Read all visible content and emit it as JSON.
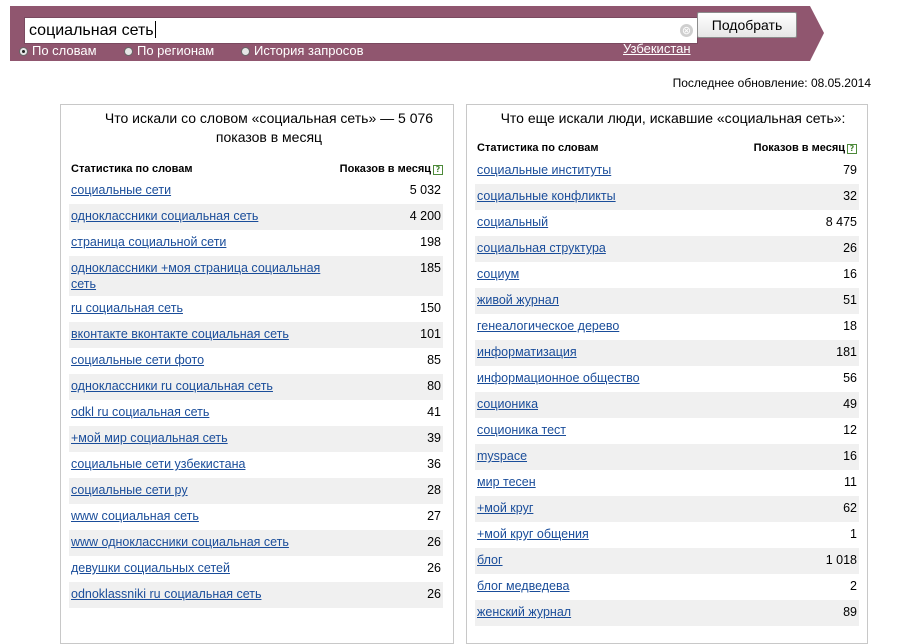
{
  "search": {
    "query": "социальная сеть",
    "button_label": "Подобрать",
    "clear_glyph": "⊗"
  },
  "modes": [
    {
      "label": "По словам",
      "selected": true
    },
    {
      "label": "По регионам",
      "selected": false
    },
    {
      "label": "История запросов",
      "selected": false
    }
  ],
  "region": "Узбекистан",
  "last_update": "Последнее обновление: 08.05.2014",
  "left_panel": {
    "title": "Что искали со словом «социальная сеть» — 5 076 показов в месяц",
    "col_phrase": "Статистика по словам",
    "col_count": "Показов в месяц",
    "rows": [
      {
        "phrase": "социальные сети",
        "count": "5 032"
      },
      {
        "phrase": "одноклассники социальная сеть",
        "count": "4 200"
      },
      {
        "phrase": "страница социальной сети",
        "count": "198"
      },
      {
        "phrase": "одноклассники +моя страница социальная сеть",
        "count": "185"
      },
      {
        "phrase": "ru социальная сеть",
        "count": "150"
      },
      {
        "phrase": "вконтакте вконтакте социальная сеть",
        "count": "101"
      },
      {
        "phrase": "социальные сети фото",
        "count": "85"
      },
      {
        "phrase": "одноклассники ru социальная сеть",
        "count": "80"
      },
      {
        "phrase": "odkl ru социальная сеть",
        "count": "41"
      },
      {
        "phrase": "+мой мир социальная сеть",
        "count": "39"
      },
      {
        "phrase": "социальные сети узбекистана",
        "count": "36"
      },
      {
        "phrase": "социальные сети ру",
        "count": "28"
      },
      {
        "phrase": "www социальная сеть",
        "count": "27"
      },
      {
        "phrase": "www одноклассники социальная сеть",
        "count": "26"
      },
      {
        "phrase": "девушки социальных сетей",
        "count": "26"
      },
      {
        "phrase": "odnoklassniki ru социальная сеть",
        "count": "26"
      }
    ]
  },
  "right_panel": {
    "title": "Что еще искали люди, искавшие «социальная сеть»:",
    "col_phrase": "Статистика по словам",
    "col_count": "Показов в месяц",
    "rows": [
      {
        "phrase": "социальные институты",
        "count": "79"
      },
      {
        "phrase": "социальные конфликты",
        "count": "32"
      },
      {
        "phrase": "социальный",
        "count": "8 475"
      },
      {
        "phrase": "социальная структура",
        "count": "26"
      },
      {
        "phrase": "социум",
        "count": "16"
      },
      {
        "phrase": "живой журнал",
        "count": "51"
      },
      {
        "phrase": "генеалогическое дерево",
        "count": "18"
      },
      {
        "phrase": "информатизация",
        "count": "181"
      },
      {
        "phrase": "информационное общество",
        "count": "56"
      },
      {
        "phrase": "соционика",
        "count": "49"
      },
      {
        "phrase": "соционика тест",
        "count": "12"
      },
      {
        "phrase": "myspace",
        "count": "16"
      },
      {
        "phrase": "мир тесен",
        "count": "11"
      },
      {
        "phrase": "+мой круг",
        "count": "62"
      },
      {
        "phrase": "+мой круг общения",
        "count": "1"
      },
      {
        "phrase": "блог",
        "count": "1 018"
      },
      {
        "phrase": "блог медведева",
        "count": "2"
      },
      {
        "phrase": "женский журнал",
        "count": "89"
      }
    ]
  }
}
